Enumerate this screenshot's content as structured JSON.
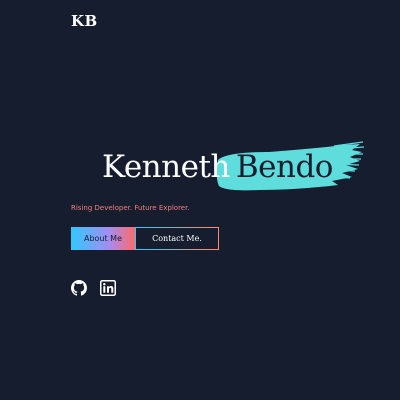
{
  "header": {
    "logo": "KB"
  },
  "hero": {
    "first_name": "Kenneth",
    "last_name": "Bendo",
    "tagline": "Rising Developer. Future Explorer.",
    "brush_color": "#5fdcdc"
  },
  "buttons": {
    "about_label": "About Me",
    "contact_label": "Contact Me."
  },
  "social": {
    "icons": [
      "github-icon",
      "linkedin-icon"
    ]
  },
  "colors": {
    "background": "#161d2f",
    "accent_cyan": "#30c8ff",
    "accent_coral": "#ff6a6a",
    "tagline": "#f08080"
  }
}
